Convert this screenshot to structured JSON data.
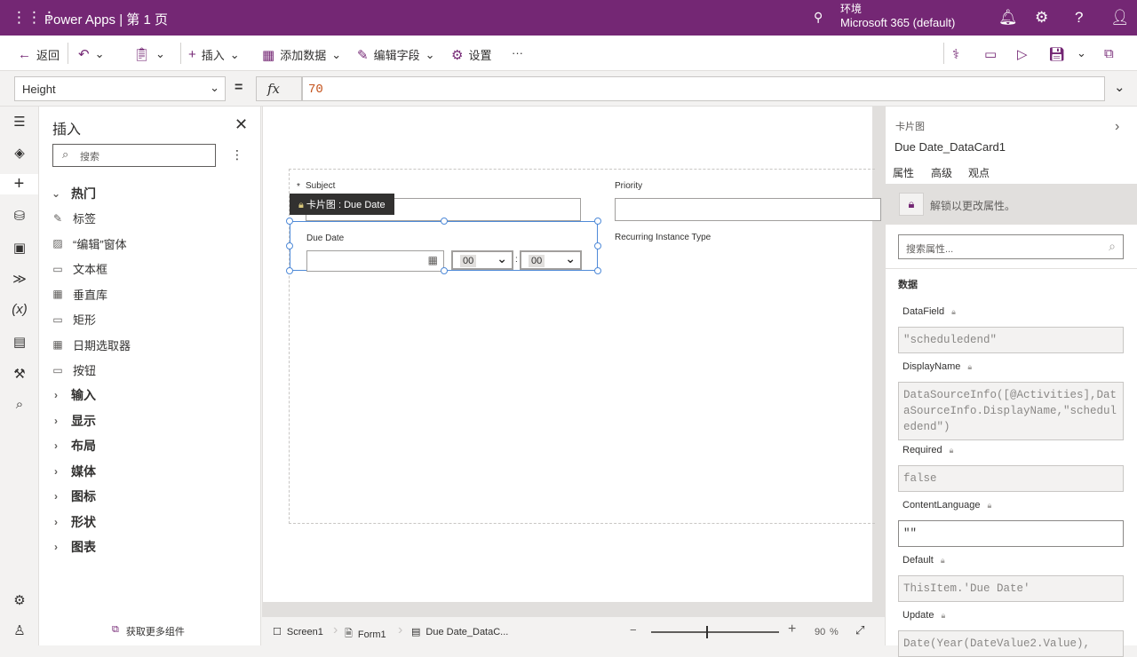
{
  "app": {
    "title": "Power Apps | 第 1 页",
    "env_label": "环境",
    "env_name": "Microsoft 365 (default)",
    "brand": "#742774"
  },
  "toolbar": {
    "back": "返回",
    "insert": "插入",
    "add_data": "添加数据",
    "edit_fields": "编辑字段",
    "settings": "设置",
    "more": "···"
  },
  "formula": {
    "property": "Height",
    "equals": "=",
    "fx": "fx",
    "value": "70"
  },
  "insert_panel": {
    "title": "插入",
    "search_placeholder": "搜索",
    "popular": "热门",
    "items": [
      {
        "icon": "label-icon",
        "label": "标签"
      },
      {
        "icon": "edit-form-icon",
        "label": "“编辑”窗体"
      },
      {
        "icon": "textbox-icon",
        "label": "文本框"
      },
      {
        "icon": "gallery-icon",
        "label": "垂直库"
      },
      {
        "icon": "rectangle-icon",
        "label": "矩形"
      },
      {
        "icon": "date-picker-icon",
        "label": "日期选取器"
      },
      {
        "icon": "button-icon",
        "label": "按钮"
      }
    ],
    "groups": [
      "输入",
      "显示",
      "布局",
      "媒体",
      "图标",
      "形状",
      "图表"
    ],
    "get_more": "获取更多组件"
  },
  "canvas": {
    "tooltip": "卡片图 : Due Date",
    "subject_label": "Subject",
    "required_mark": "*",
    "priority_label": "Priority",
    "due_date_label": "Due Date",
    "hour": "00",
    "minute": "00",
    "colon": ":",
    "recurring_label": "Recurring Instance Type"
  },
  "bottom": {
    "crumbs": [
      "Screen1",
      "Form1",
      "Due Date_DataC..."
    ],
    "zoom": "90",
    "zoom_unit": "%",
    "zoom_value": 90
  },
  "right_panel": {
    "type": "卡片图",
    "name": "Due Date_DataCard1",
    "tabs": [
      "属性",
      "高级",
      "观点"
    ],
    "active_tab": "高级",
    "unlock": "解锁以更改属性。",
    "search_placeholder": "搜索属性...",
    "section": "数据",
    "fields": [
      {
        "label": "DataField",
        "value": "\"scheduledend\""
      },
      {
        "label": "DisplayName",
        "value": "DataSourceInfo([@Activities],DataSourceInfo.DisplayName,\"scheduledend\")"
      },
      {
        "label": "Required",
        "value": "false"
      },
      {
        "label": "ContentLanguage",
        "value": "\"\""
      },
      {
        "label": "Default",
        "value": "ThisItem.'Due Date'"
      },
      {
        "label": "Update",
        "value": "Date(Year(DateValue2.Value),"
      }
    ]
  }
}
